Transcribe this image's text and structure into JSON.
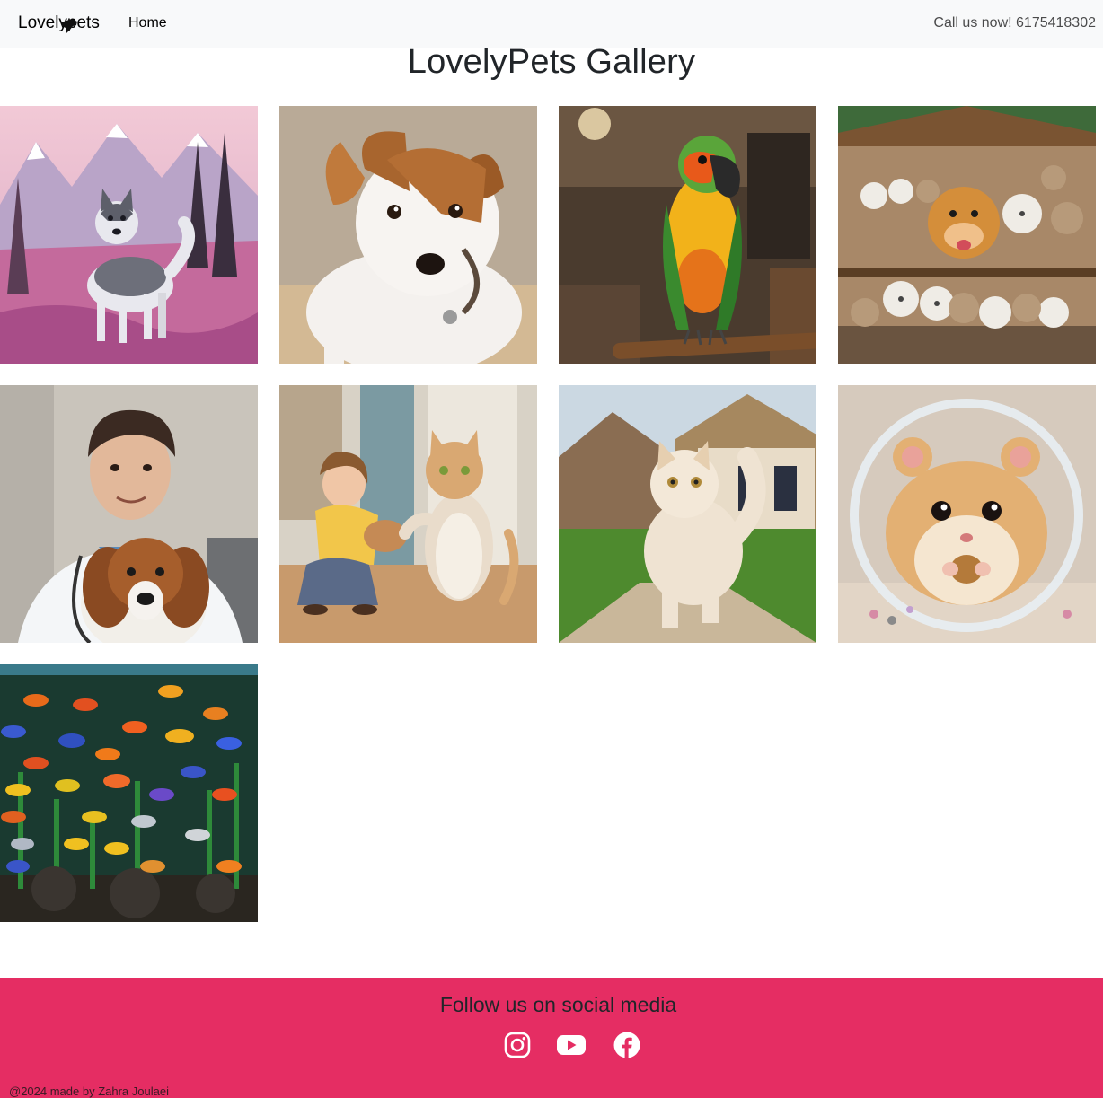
{
  "navbar": {
    "brand": "Lovelypets",
    "home_label": "Home",
    "phone": "Call us now! 6175418302"
  },
  "page_title": "LovelyPets Gallery",
  "gallery": {
    "images": [
      "husky-in-mountains",
      "jack-russell-terrier",
      "parrot-on-perch",
      "group-of-cats-and-dogs",
      "vet-with-dog",
      "girl-with-cats",
      "fluffy-cat-outdoors",
      "hamster-in-ball",
      "aquarium-fish"
    ]
  },
  "footer": {
    "title": "Follow us on social media",
    "icons": [
      "instagram-icon",
      "youtube-icon",
      "facebook-icon"
    ],
    "copyright": "@2024 made by Zahra Joulaei"
  },
  "colors": {
    "navbar_bg": "#f8f9fa",
    "footer_bg": "#e52d63",
    "text": "#212529"
  }
}
